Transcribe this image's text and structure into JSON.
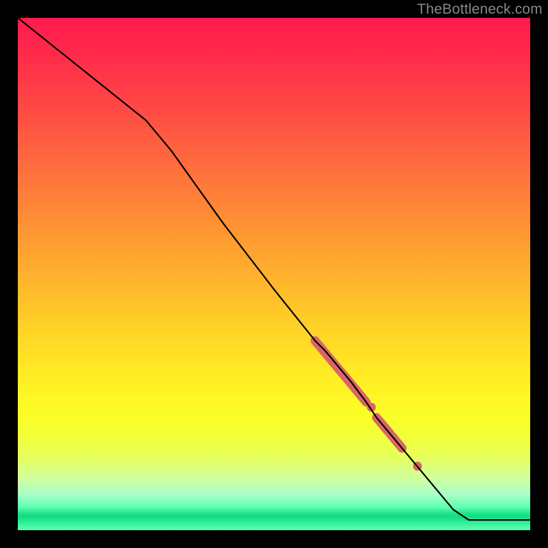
{
  "watermark": "TheBottleneck.com",
  "colors": {
    "frame": "#000000",
    "line": "#000000",
    "marker": "#d96666",
    "marker_fuzz": "#e08080"
  },
  "chart_data": {
    "type": "line",
    "title": "",
    "xlabel": "",
    "ylabel": "",
    "xlim": [
      0,
      100
    ],
    "ylim": [
      0,
      100
    ],
    "grid": false,
    "legend": false,
    "series": [
      {
        "name": "bottleneck-curve",
        "x": [
          0,
          25,
          30,
          40,
          50,
          58,
          60,
          65,
          68,
          70,
          75,
          80,
          85,
          88,
          100
        ],
        "y": [
          100,
          80,
          74,
          60,
          47,
          37,
          35,
          29,
          25,
          22,
          16,
          10,
          4,
          2,
          2
        ]
      }
    ],
    "markers": [
      {
        "name": "highlight-segment-1",
        "kind": "thick-line",
        "x": [
          58,
          68
        ],
        "y": [
          37,
          25
        ]
      },
      {
        "name": "highlight-segment-2",
        "kind": "thick-line",
        "x": [
          70,
          75
        ],
        "y": [
          22,
          16
        ]
      },
      {
        "name": "highlight-dot-1",
        "kind": "dot",
        "x": 69,
        "y": 24
      },
      {
        "name": "highlight-dot-2",
        "kind": "dot",
        "x": 78,
        "y": 12.5
      }
    ]
  }
}
